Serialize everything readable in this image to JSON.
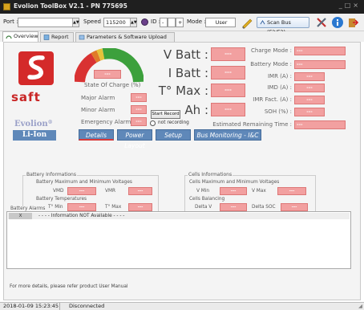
{
  "window": {
    "title": "Evolion ToolBox V2.1 - PN 775695"
  },
  "toolbar": {
    "port_label": "Port :",
    "port_value": "",
    "speed_label": "Speed :",
    "speed_value": "115200",
    "id_label": "ID :",
    "id_value": "",
    "mode_label": "Mode :",
    "mode_value": "User",
    "scan_label": "Scan Bus (F2/F3)"
  },
  "tabs": [
    {
      "label": "Overview"
    },
    {
      "label": "Report"
    },
    {
      "label": "Parameters & Software Upload"
    }
  ],
  "brand": {
    "saft": "saft",
    "evolion": "Evolion",
    "reg": "®",
    "liion": "Li-Ion"
  },
  "gauge": {
    "label": "State Of Charge (%)",
    "value": "---",
    "level": null
  },
  "alarms": [
    {
      "label": "Major Alarm",
      "value": "---"
    },
    {
      "label": "Minor Alarm",
      "value": "---"
    },
    {
      "label": "Emergency Alarm",
      "value": "---"
    }
  ],
  "main_values": [
    {
      "label": "V Batt :",
      "value": "---"
    },
    {
      "label": "I Batt :",
      "value": "---"
    },
    {
      "label": "T° Max :",
      "value": "---"
    },
    {
      "label": "Ah :",
      "value": "---"
    }
  ],
  "recording": {
    "button": "Start Record",
    "status": "not recording"
  },
  "right_values": [
    {
      "label": "Charge Mode :",
      "value": "---"
    },
    {
      "label": "Battery Mode :",
      "value": "---"
    },
    {
      "label": "IMR (A) :",
      "value": "---"
    },
    {
      "label": "IMD (A) :",
      "value": "---"
    },
    {
      "label": "IMR Fact. (A) :",
      "value": "---"
    },
    {
      "label": "SOH (%) :",
      "value": "---"
    }
  ],
  "remaining": {
    "label": "Estimated Remaining Time :",
    "value": "---"
  },
  "nav": [
    "Details",
    "Power Layout",
    "Setup",
    "Bus Monitoring - I&C"
  ],
  "battery_info": {
    "title": "Battery Informations",
    "voltages_title": "Battery Maximum and Minimum Voltages",
    "vmd_label": "VMD",
    "vmd_value": "---",
    "vmr_label": "VMR",
    "vmr_value": "---",
    "temps_title": "Battery Temperatures",
    "tmin_label": "T° Min",
    "tmin_value": "---",
    "tmax_label": "T° Max",
    "tmax_value": "---"
  },
  "cells_info": {
    "title": "Cells Informations",
    "voltages_title": "Cells Maximum and Minimum Voltages",
    "vmin_label": "V Min",
    "vmin_value": "---",
    "vmax_label": "V Max",
    "vmax_value": "---",
    "balancing_title": "Cells Balancing",
    "deltav_label": "Delta V",
    "deltav_value": "---",
    "deltasoc_label": "Delta SOC",
    "deltasoc_value": "---"
  },
  "battery_alarms": {
    "title": "Battery Alarms",
    "rows": [
      {
        "marker": "X",
        "text": "- - - - Information NOT Available - - - -"
      }
    ]
  },
  "footer_note": "For more details, please refer product User Manual",
  "status": {
    "datetime": "2018-01-09 15:23:45",
    "connection": "Disconnected"
  }
}
